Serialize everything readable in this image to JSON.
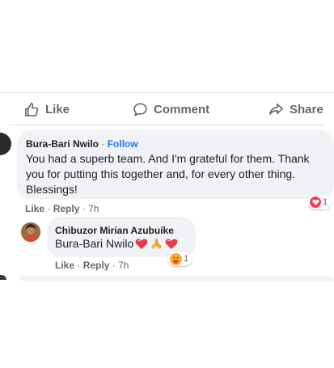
{
  "actions": {
    "like_label": "Like",
    "comment_label": "Comment",
    "share_label": "Share"
  },
  "comments": [
    {
      "author": "Bura-Bari Nwilo",
      "separator": "·",
      "follow_label": "Follow",
      "text": "You had a superb team. And I'm grateful for them. Thank you for putting this together and, for every other thing. Blessings!",
      "reaction_count": "1",
      "reaction_type": "heart-icon",
      "like_label": "Like",
      "reply_label": "Reply",
      "meta_separator": "·",
      "time": "7h"
    }
  ],
  "reply": {
    "author": "Chibuzor Mirian Azubuike",
    "mention": "Bura-Bari Nwilo",
    "emojis": [
      "heart-icon",
      "folded-hands-icon",
      "heart-icon"
    ],
    "reaction_count": "1",
    "reaction_type": "care-icon",
    "like_label": "Like",
    "reply_label": "Reply",
    "meta_separator": "·",
    "time": "7h"
  },
  "colors": {
    "link_blue": "#1877f2",
    "bubble_gray": "#f0f2f5",
    "meta_gray": "#65676b",
    "heart_red": "#f33e58"
  }
}
